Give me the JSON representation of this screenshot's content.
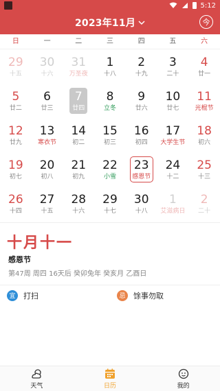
{
  "status": {
    "time": "5:12"
  },
  "header": {
    "title": "2023年11月",
    "today_label": "今"
  },
  "weekdays": [
    "日",
    "一",
    "二",
    "三",
    "四",
    "五",
    "六"
  ],
  "weeks": [
    [
      {
        "d": "29",
        "s": "十五",
        "flags": [
          "faded",
          "red"
        ]
      },
      {
        "d": "30",
        "s": "十六",
        "flags": [
          "faded"
        ]
      },
      {
        "d": "31",
        "s": "万圣夜",
        "flags": [
          "faded",
          "redsub"
        ]
      },
      {
        "d": "1",
        "s": "十八",
        "flags": []
      },
      {
        "d": "2",
        "s": "十九",
        "flags": []
      },
      {
        "d": "3",
        "s": "二十",
        "flags": []
      },
      {
        "d": "4",
        "s": "廿一",
        "flags": [
          "red"
        ]
      }
    ],
    [
      {
        "d": "5",
        "s": "廿二",
        "flags": [
          "red"
        ]
      },
      {
        "d": "6",
        "s": "廿三",
        "flags": []
      },
      {
        "d": "7",
        "s": "廿四",
        "flags": [
          "today"
        ]
      },
      {
        "d": "8",
        "s": "立冬",
        "flags": [
          "greensub"
        ]
      },
      {
        "d": "9",
        "s": "廿六",
        "flags": []
      },
      {
        "d": "10",
        "s": "廿七",
        "flags": []
      },
      {
        "d": "11",
        "s": "光棍节",
        "flags": [
          "red",
          "redsub"
        ]
      }
    ],
    [
      {
        "d": "12",
        "s": "廿九",
        "flags": [
          "red"
        ]
      },
      {
        "d": "13",
        "s": "寒衣节",
        "flags": [
          "redsub"
        ]
      },
      {
        "d": "14",
        "s": "初二",
        "flags": []
      },
      {
        "d": "15",
        "s": "初三",
        "flags": []
      },
      {
        "d": "16",
        "s": "初四",
        "flags": []
      },
      {
        "d": "17",
        "s": "大学生节",
        "flags": [
          "redsub"
        ]
      },
      {
        "d": "18",
        "s": "初六",
        "flags": [
          "red"
        ]
      }
    ],
    [
      {
        "d": "19",
        "s": "初七",
        "flags": [
          "red"
        ]
      },
      {
        "d": "20",
        "s": "初八",
        "flags": []
      },
      {
        "d": "21",
        "s": "初九",
        "flags": []
      },
      {
        "d": "22",
        "s": "小雪",
        "flags": [
          "greensub"
        ]
      },
      {
        "d": "23",
        "s": "感恩节",
        "flags": [
          "selected",
          "redsub"
        ]
      },
      {
        "d": "24",
        "s": "十二",
        "flags": []
      },
      {
        "d": "25",
        "s": "十三",
        "flags": [
          "red"
        ]
      }
    ],
    [
      {
        "d": "26",
        "s": "十四",
        "flags": [
          "red"
        ]
      },
      {
        "d": "27",
        "s": "十五",
        "flags": []
      },
      {
        "d": "28",
        "s": "十六",
        "flags": []
      },
      {
        "d": "29",
        "s": "十七",
        "flags": []
      },
      {
        "d": "30",
        "s": "十八",
        "flags": []
      },
      {
        "d": "1",
        "s": "艾滋病日",
        "flags": [
          "faded",
          "redsub"
        ]
      },
      {
        "d": "2",
        "s": "二十",
        "flags": [
          "faded",
          "red"
        ]
      }
    ]
  ],
  "detail": {
    "lunar_date": "十月十一",
    "festival": "感恩节",
    "info": "第47周 周四 16天后 癸卯兔年 癸亥月 乙酉日"
  },
  "yiji": {
    "yi_badge": "宜",
    "yi_text": "打扫",
    "ji_badge": "忌",
    "ji_text": "馀事勿取"
  },
  "tabs": [
    {
      "label": "天气",
      "icon": "weather-icon"
    },
    {
      "label": "日历",
      "icon": "calendar-icon",
      "active": true
    },
    {
      "label": "我的",
      "icon": "profile-icon"
    }
  ],
  "colors": {
    "accent": "#d64a49",
    "green": "#2e9a58",
    "yi": "#2f8fd8",
    "ji": "#e9844a",
    "active_tab": "#f0a22e"
  }
}
